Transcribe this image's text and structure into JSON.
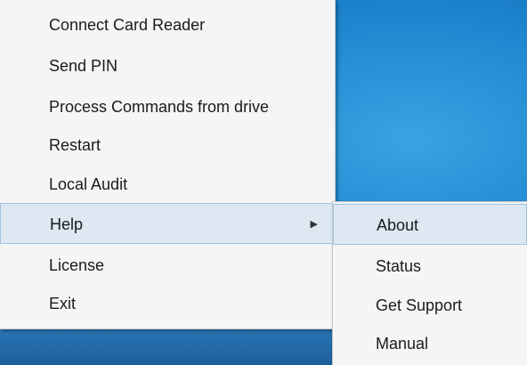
{
  "main_menu": {
    "items": [
      {
        "label": "Connect Card Reader"
      },
      {
        "label": "Send PIN"
      },
      {
        "label": "Process Commands from drive"
      },
      {
        "label": "Restart"
      },
      {
        "label": "Local Audit"
      },
      {
        "label": "Help",
        "has_submenu": true,
        "highlighted": true
      },
      {
        "label": "License"
      },
      {
        "label": "Exit"
      }
    ]
  },
  "help_submenu": {
    "items": [
      {
        "label": "About",
        "highlighted": true
      },
      {
        "label": "Status"
      },
      {
        "label": "Get Support"
      },
      {
        "label": "Manual"
      }
    ]
  },
  "colors": {
    "menu_background": "#f5f5f5",
    "highlight_background": "#dde8f3",
    "highlight_border": "#9ec3e6",
    "desktop_blue": "#1d86cf"
  }
}
